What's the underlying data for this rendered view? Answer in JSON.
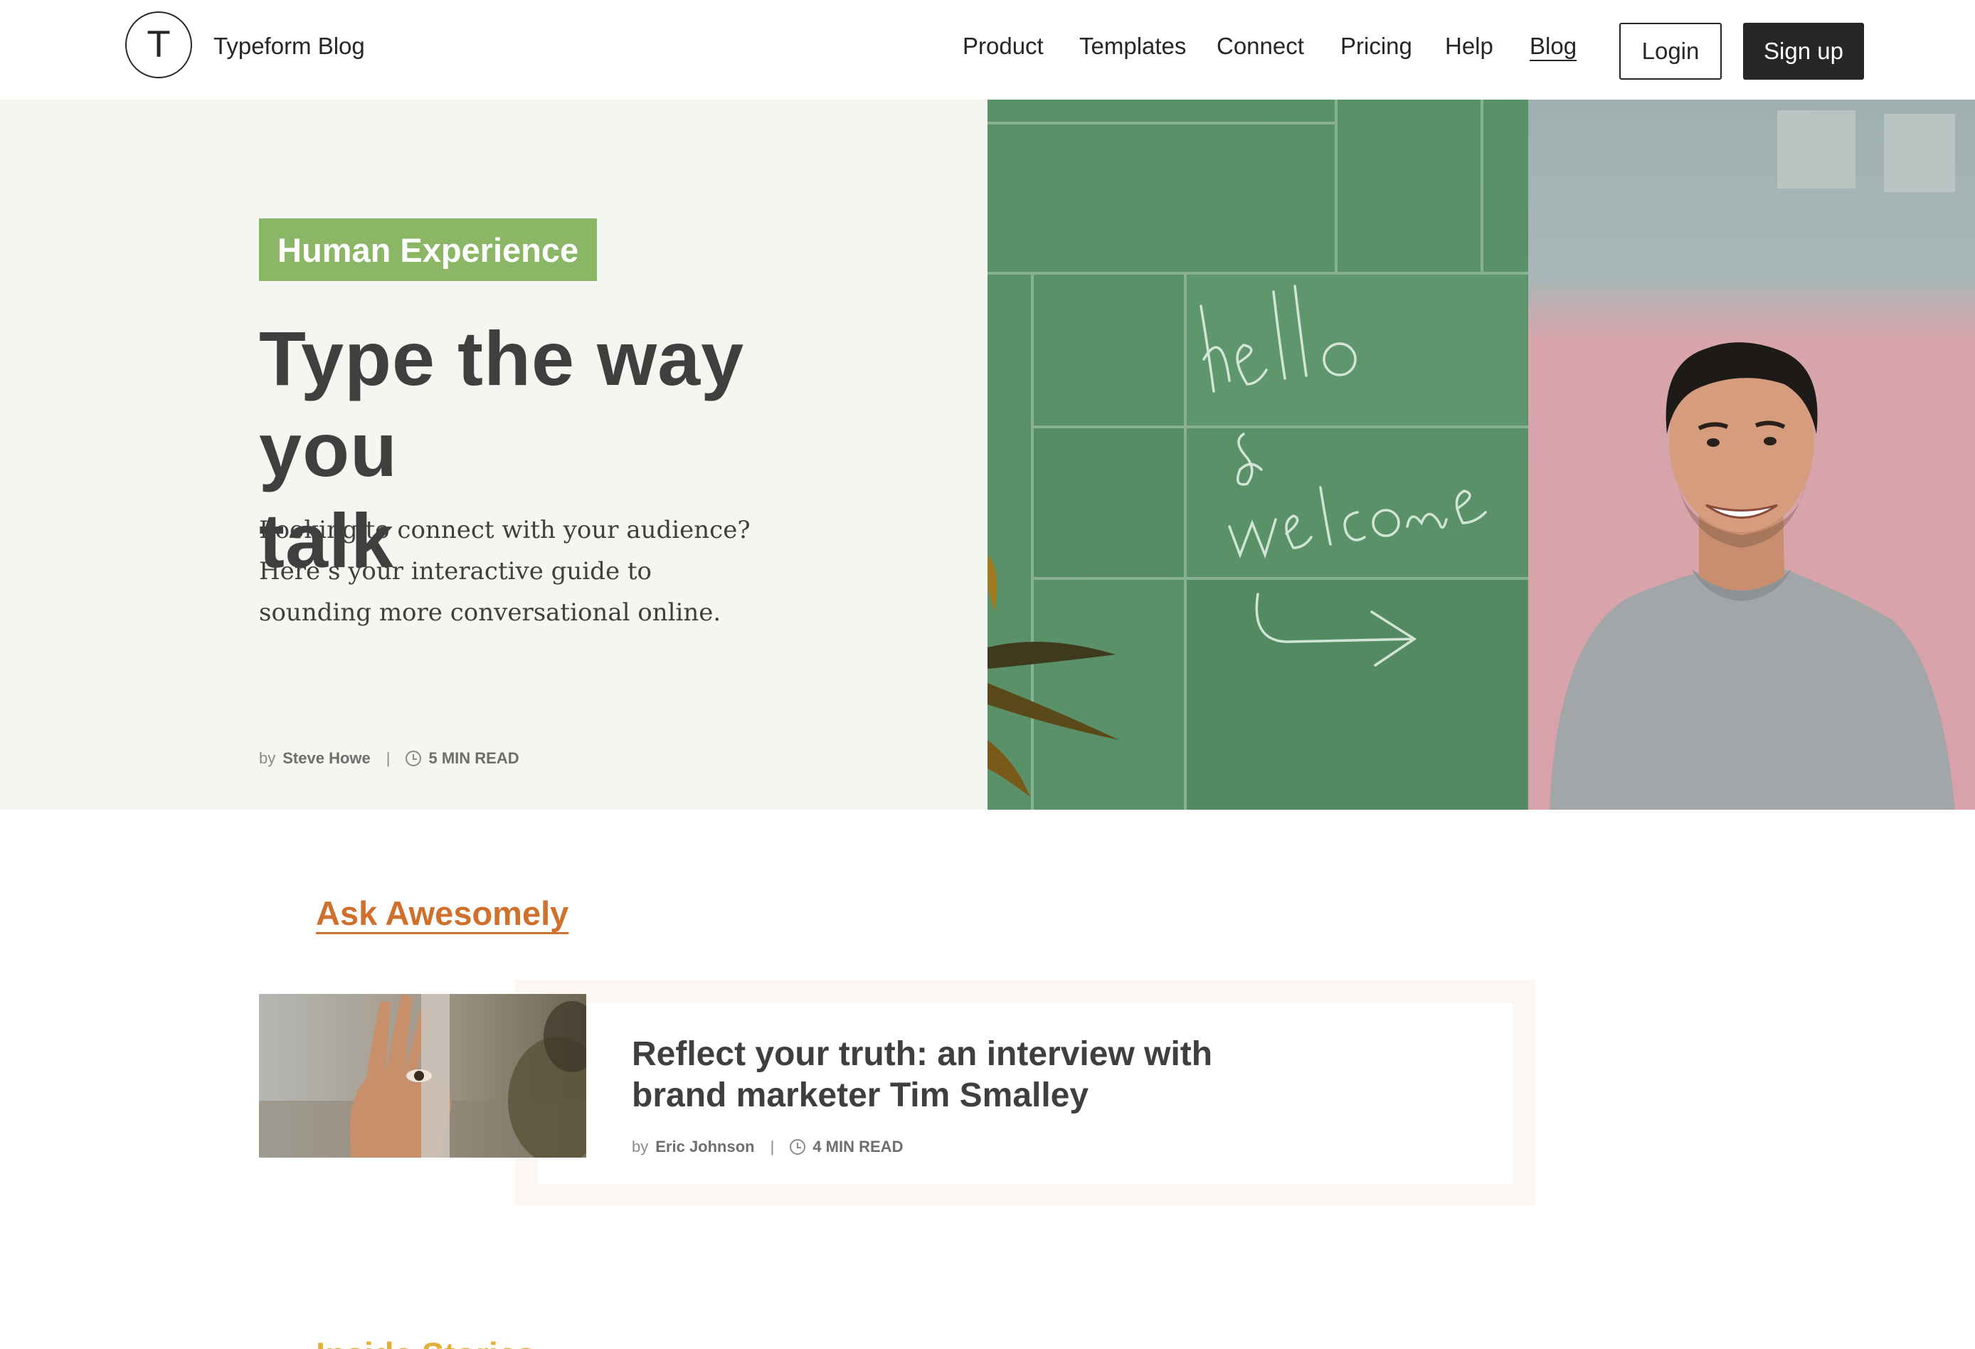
{
  "header": {
    "brand": "Typeform Blog",
    "logo_letter": "T",
    "nav": [
      "Product",
      "Templates",
      "Connect",
      "Pricing",
      "Help",
      "Blog"
    ],
    "active_nav": "Blog",
    "login_label": "Login",
    "signup_label": "Sign up"
  },
  "hero": {
    "category": "Human Experience",
    "title_line1": "Type the way you",
    "title_line2": "talk",
    "description_line1": "Looking to connect with your audience?",
    "description_line2": "Here’s your interactive guide to",
    "description_line3": "sounding more conversational online.",
    "author_prefix": "by",
    "author": "Steve Howe",
    "separator": "|",
    "read_time": "5 MIN READ",
    "image_text": [
      "hello",
      "&",
      "welcome"
    ]
  },
  "section": {
    "category": "Ask Awesomely",
    "article": {
      "title_line1": "Reflect your truth: an interview with",
      "title_line2": "brand marketer Tim Smalley",
      "author_prefix": "by",
      "author": "Eric Johnson",
      "separator": "|",
      "read_time": "4 MIN READ"
    },
    "next_category": "Inside Stories"
  },
  "colors": {
    "hero_bg": "#f3f7f0",
    "badge": "#8ab665",
    "ask_awesomely": "#d0702d",
    "inside_stories": "#e3b03a",
    "dark": "#262627"
  }
}
